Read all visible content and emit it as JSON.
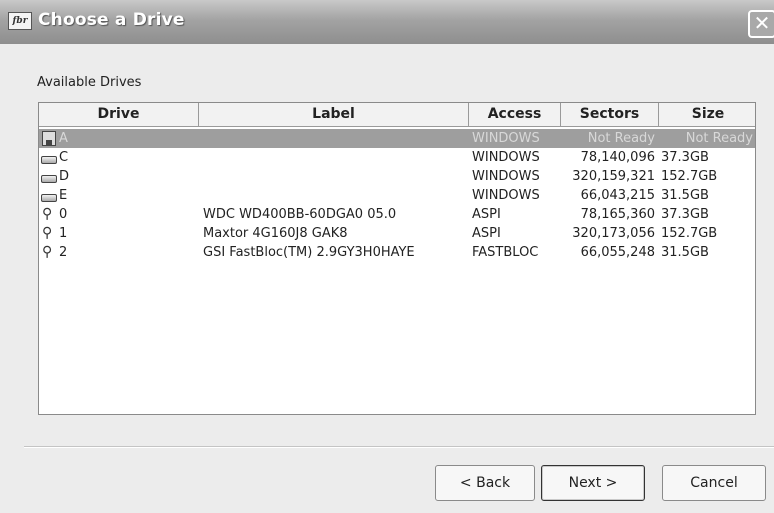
{
  "window": {
    "title": "Choose a Drive",
    "icon": "app-icon",
    "close_label": "✕"
  },
  "section_label": "Available Drives",
  "columns": [
    {
      "label": "Drive"
    },
    {
      "label": "Label"
    },
    {
      "label": "Access"
    },
    {
      "label": "Sectors"
    },
    {
      "label": "Size"
    }
  ],
  "drives": [
    {
      "icon": "floppy-drive-icon",
      "drive": "A",
      "label": "",
      "access": "WINDOWS",
      "sectors": "Not Ready",
      "size": "Not Ready",
      "selected": true
    },
    {
      "icon": "hard-drive-icon",
      "drive": "C",
      "label": "",
      "access": "WINDOWS",
      "sectors": "78,140,096",
      "size": "37.3GB"
    },
    {
      "icon": "hard-drive-icon",
      "drive": "D",
      "label": "",
      "access": "WINDOWS",
      "sectors": "320,159,321",
      "size": "152.7GB"
    },
    {
      "icon": "hard-drive-icon",
      "drive": "E",
      "label": "",
      "access": "WINDOWS",
      "sectors": "66,043,215",
      "size": "31.5GB"
    },
    {
      "icon": "physical-drive-icon",
      "drive": "0",
      "label": "WDC WD400BB-60DGA0     05.0",
      "access": "ASPI",
      "sectors": "78,165,360",
      "size": "37.3GB"
    },
    {
      "icon": "physical-drive-icon",
      "drive": "1",
      "label": "Maxtor 4G160J8          GAK8",
      "access": "ASPI",
      "sectors": "320,173,056",
      "size": "152.7GB"
    },
    {
      "icon": "physical-drive-icon",
      "drive": "2",
      "label": "GSI    FastBloc(TM)    2.9GY3H0HAYE",
      "access": "FASTBLOC",
      "sectors": "66,055,248",
      "size": "31.5GB"
    }
  ],
  "buttons": {
    "back": "< Back",
    "next": "Next >",
    "cancel": "Cancel"
  }
}
